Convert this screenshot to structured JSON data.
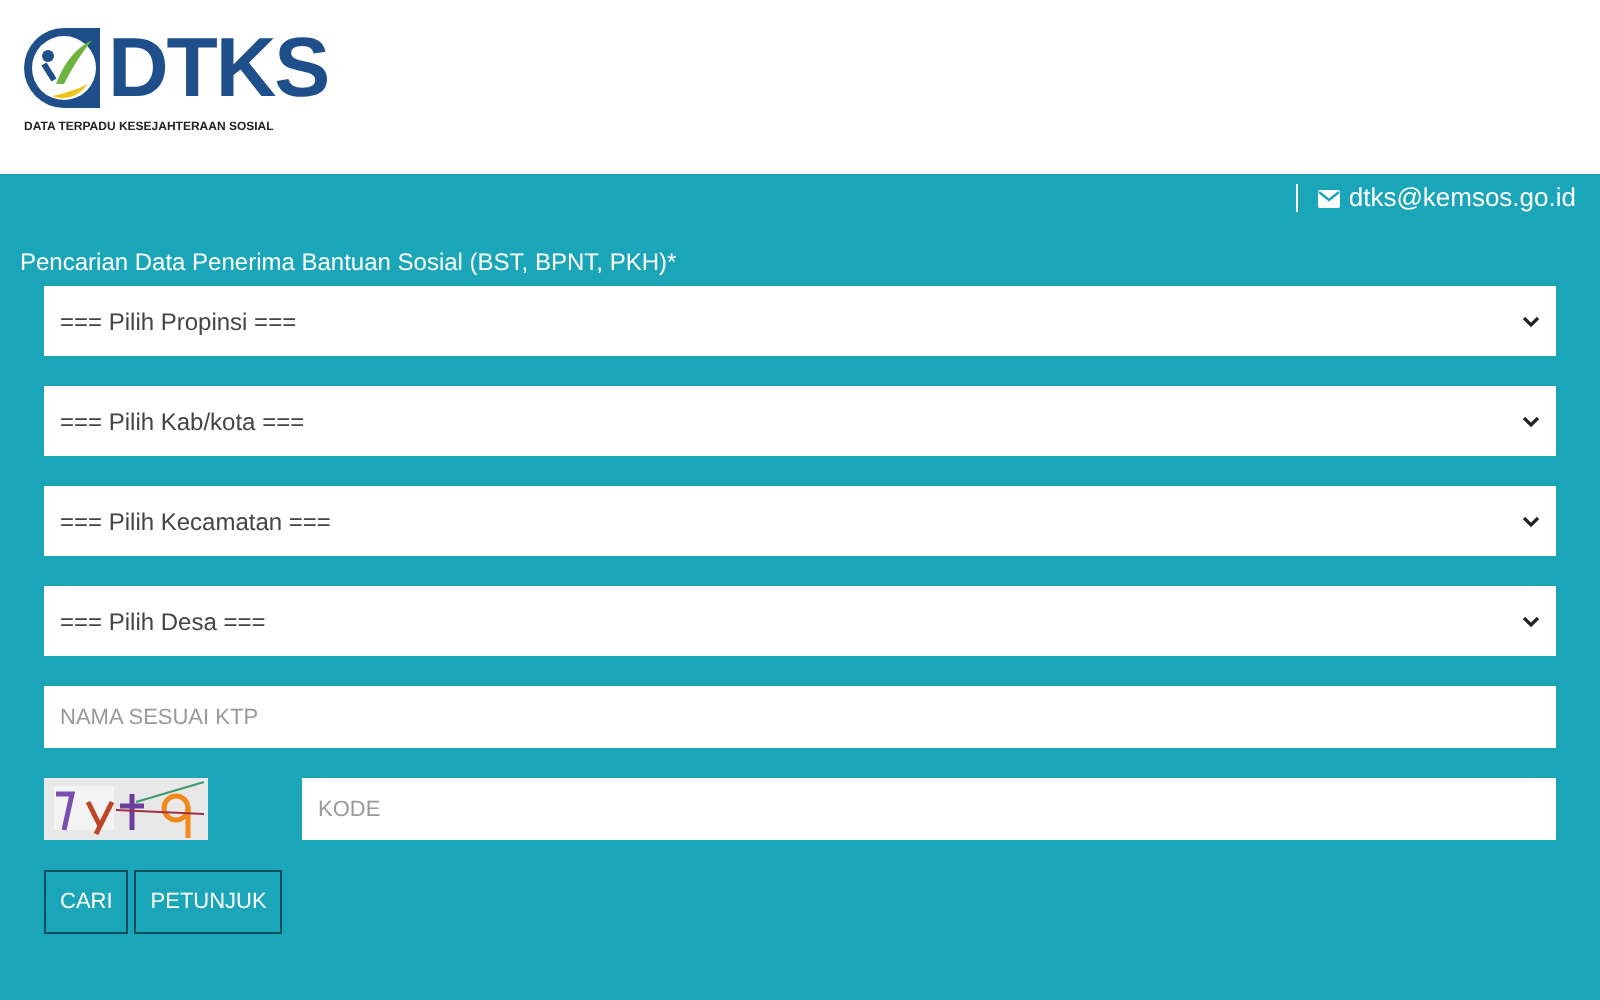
{
  "logo": {
    "title": "DTKS",
    "subtitle": "DATA TERPADU KESEJAHTERAAN SOSIAL"
  },
  "contact": {
    "email": "dtks@kemsos.go.id"
  },
  "form": {
    "title": "Pencarian Data Penerima Bantuan Sosial (BST, BPNT, PKH)*",
    "selects": [
      {
        "value": "=== Pilih Propinsi ==="
      },
      {
        "value": "=== Pilih Kab/kota ==="
      },
      {
        "value": "=== Pilih Kecamatan ==="
      },
      {
        "value": "=== Pilih Desa ==="
      }
    ],
    "name_field": {
      "placeholder": "NAMA SESUAI KTP"
    },
    "code_field": {
      "placeholder": "KODE"
    },
    "buttons": [
      "CARI",
      "PETUNJUK"
    ]
  }
}
